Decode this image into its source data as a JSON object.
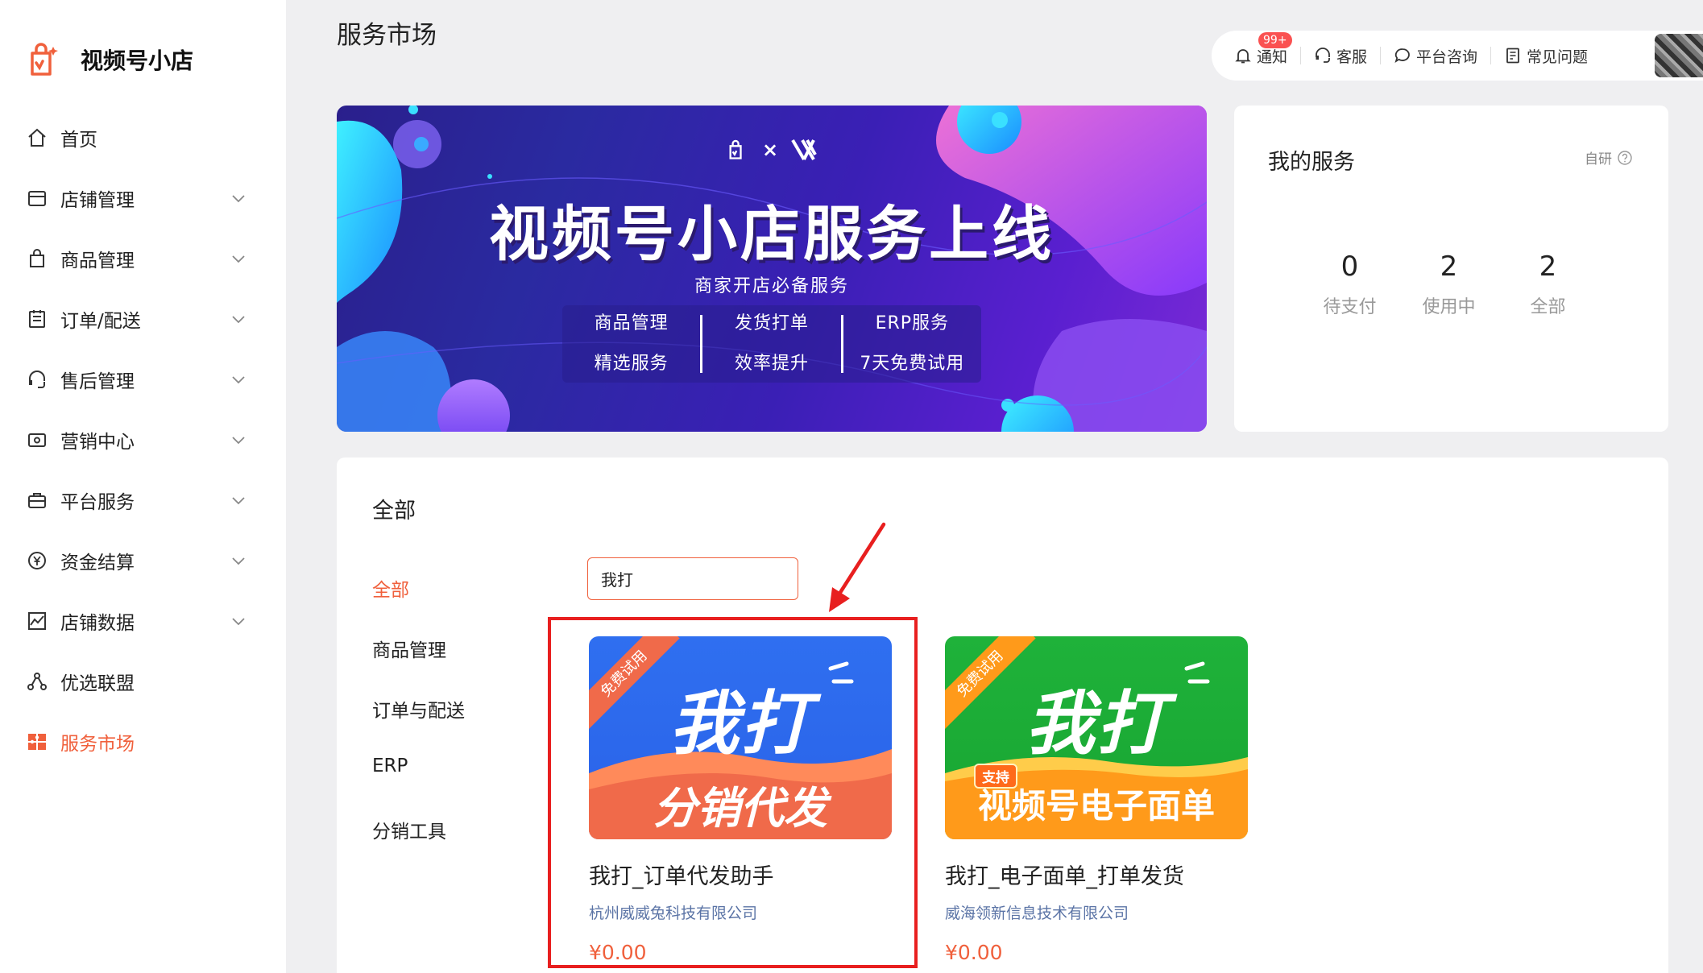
{
  "app": {
    "name": "视频号小店"
  },
  "sidebar": {
    "items": [
      {
        "label": "首页",
        "icon": "home-icon"
      },
      {
        "label": "店铺管理",
        "icon": "store-icon"
      },
      {
        "label": "商品管理",
        "icon": "bag-icon"
      },
      {
        "label": "订单/配送",
        "icon": "order-icon"
      },
      {
        "label": "售后管理",
        "icon": "headset-icon"
      },
      {
        "label": "营销中心",
        "icon": "coupon-icon"
      },
      {
        "label": "平台服务",
        "icon": "briefcase-icon"
      },
      {
        "label": "资金结算",
        "icon": "yuan-icon"
      },
      {
        "label": "店铺数据",
        "icon": "chart-icon"
      },
      {
        "label": "优选联盟",
        "icon": "network-icon"
      },
      {
        "label": "服务市场",
        "icon": "puzzle-icon",
        "active": true
      }
    ]
  },
  "header": {
    "title": "服务市场",
    "notify": "通知",
    "badge": "99+",
    "service": "客服",
    "consult": "平台咨询",
    "faq": "常见问题"
  },
  "banner": {
    "title": "视频号小店服务上线",
    "subtitle": "商家开店必备服务",
    "col1": [
      "商品管理",
      "精选服务"
    ],
    "col2": [
      "发货打单",
      "效率提升"
    ],
    "col3": [
      "ERP服务",
      "7天免费试用"
    ],
    "times": "×"
  },
  "my_service": {
    "title": "我的服务",
    "self": "自研",
    "stats": [
      {
        "num": "0",
        "label": "待支付"
      },
      {
        "num": "2",
        "label": "使用中"
      },
      {
        "num": "2",
        "label": "全部"
      }
    ]
  },
  "main": {
    "title": "全部",
    "categories": [
      "全部",
      "商品管理",
      "订单与配送",
      "ERP",
      "分销工具"
    ],
    "search_value": "我打"
  },
  "cards": [
    {
      "ribbon": "免费试用",
      "brand": "我打",
      "bottom": "分销代发",
      "name": "我打_订单代发助手",
      "company": "杭州威威兔科技有限公司",
      "price": "¥0.00"
    },
    {
      "ribbon": "免费试用",
      "brand": "我打",
      "tag": "支持",
      "bottom": "视频号电子面单",
      "name": "我打_电子面单_打单发货",
      "company": "威海领新信息技术有限公司",
      "price": "¥0.00"
    }
  ],
  "colors": {
    "accent": "#f0603c",
    "highlight": "#e81f1f",
    "link": "#5b74a6"
  }
}
